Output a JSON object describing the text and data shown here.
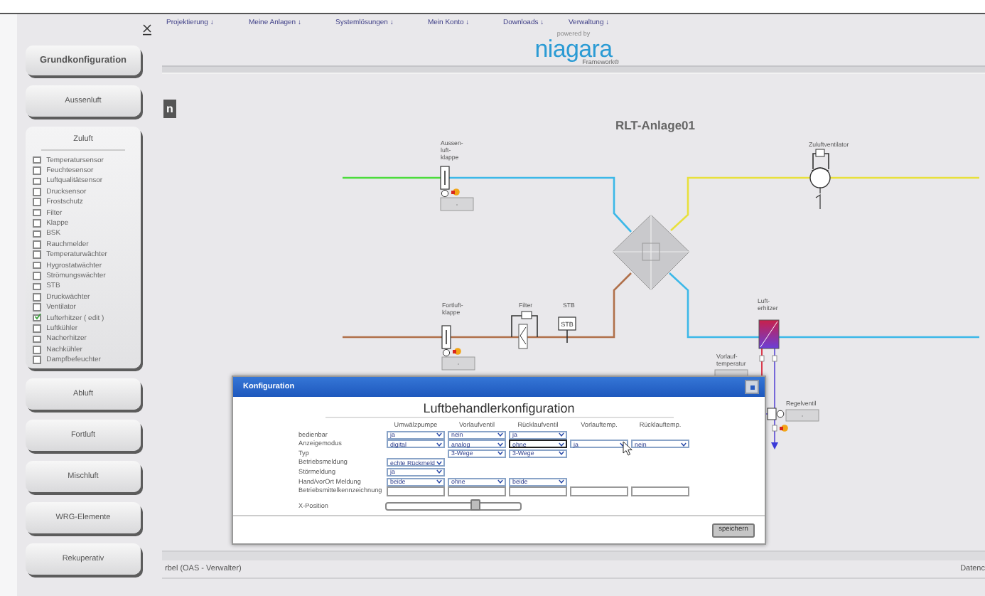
{
  "sidebar": {
    "sections": [
      {
        "label": "Grundkonfiguration",
        "expanded": false
      },
      {
        "label": "Aussenluft",
        "expanded": false
      },
      {
        "label": "Zuluft",
        "expanded": true,
        "options": [
          {
            "label": "Temperatursensor",
            "checked": false
          },
          {
            "label": "Feuchtesensor",
            "checked": false
          },
          {
            "label": "Luftqualitätsensor",
            "checked": false
          },
          {
            "label": "Drucksensor",
            "checked": false
          },
          {
            "label": "Frostschutz",
            "checked": false
          },
          {
            "label": "Filter",
            "checked": false
          },
          {
            "label": "Klappe",
            "checked": false
          },
          {
            "label": "BSK",
            "checked": false
          },
          {
            "label": "Rauchmelder",
            "checked": false
          },
          {
            "label": "Temperaturwächter",
            "checked": false
          },
          {
            "label": "Hygrostatwächter",
            "checked": false
          },
          {
            "label": "Strömungswächter",
            "checked": false
          },
          {
            "label": "STB",
            "checked": false
          },
          {
            "label": "Druckwächter",
            "checked": false
          },
          {
            "label": "Ventilator",
            "checked": false
          },
          {
            "label": "Lufterhitzer ( edit )",
            "checked": true
          },
          {
            "label": "Luftkühler",
            "checked": false
          },
          {
            "label": "Nacherhitzer",
            "checked": false
          },
          {
            "label": "Nachkühler",
            "checked": false
          },
          {
            "label": "Dampfbefeuchter",
            "checked": false
          }
        ]
      },
      {
        "label": "Abluft",
        "expanded": false
      },
      {
        "label": "Fortluft",
        "expanded": false
      },
      {
        "label": "Mischluft",
        "expanded": false
      },
      {
        "label": "WRG-Elemente",
        "expanded": false
      },
      {
        "label": "Rekuperativ",
        "expanded": false
      }
    ]
  },
  "nav": [
    "Projektierung ↓",
    "Meine Anlagen ↓",
    "Systemlösungen ↓",
    "Mein Konto ↓",
    "Downloads ↓",
    "Verwaltung ↓"
  ],
  "logo": {
    "tagline": "powered by",
    "name": "niagara",
    "suffix": "Framework®"
  },
  "tab": {
    "label": "n"
  },
  "diagram": {
    "title": "RLT-Anlage01",
    "components": [
      {
        "kind": "damper",
        "label": [
          "Aussen-",
          "luft-",
          "klappe"
        ],
        "display": "-"
      },
      {
        "kind": "damper",
        "label": [
          "Fortluft-",
          "klappe"
        ],
        "display": "-"
      },
      {
        "kind": "filter",
        "label": [
          "Filter"
        ]
      },
      {
        "kind": "stb",
        "label": [
          "STB"
        ],
        "display": "STB"
      },
      {
        "kind": "fan",
        "label": [
          "Zuluftventilator"
        ]
      },
      {
        "kind": "heater",
        "label": [
          "Luft-",
          "erhitzer"
        ]
      },
      {
        "kind": "sensor",
        "label": [
          "Vorlauf-",
          "temperatur"
        ]
      },
      {
        "kind": "valve",
        "label": [
          "Regelventil"
        ],
        "display": "-"
      }
    ]
  },
  "dialog": {
    "title": "Konfiguration",
    "heading": "Luftbehandlerkonfiguration",
    "columns": [
      "Umwälzpumpe",
      "Vorlaufventil",
      "Rücklaufventil",
      "Vorlauftemp.",
      "Rücklauftemp."
    ],
    "rows": [
      {
        "label": "bedienbar",
        "cells": [
          {
            "kind": "select",
            "value": "ja",
            "focused": false
          },
          {
            "kind": "select",
            "value": "nein",
            "focused": false
          },
          {
            "kind": "select",
            "value": "ja",
            "focused": false
          },
          {
            "kind": "empty"
          },
          {
            "kind": "empty"
          }
        ]
      },
      {
        "label": "Anzeigemodus",
        "cells": [
          {
            "kind": "select",
            "value": "digital",
            "focused": false
          },
          {
            "kind": "select",
            "value": "analog",
            "focused": false
          },
          {
            "kind": "select",
            "value": "ohne",
            "focused": true
          },
          {
            "kind": "select",
            "value": "ja",
            "focused": false
          },
          {
            "kind": "select",
            "value": "nein",
            "focused": false
          }
        ]
      },
      {
        "label": "Typ",
        "cells": [
          {
            "kind": "empty"
          },
          {
            "kind": "select",
            "value": "3-Wege",
            "focused": false
          },
          {
            "kind": "select",
            "value": "3-Wege",
            "focused": false
          },
          {
            "kind": "empty"
          },
          {
            "kind": "empty"
          }
        ]
      },
      {
        "label": "Betriebsmeldung",
        "cells": [
          {
            "kind": "select",
            "value": "echte Rückmeld",
            "focused": false
          },
          {
            "kind": "empty"
          },
          {
            "kind": "empty"
          },
          {
            "kind": "empty"
          },
          {
            "kind": "empty"
          }
        ]
      },
      {
        "label": "Störmeldung",
        "cells": [
          {
            "kind": "select",
            "value": "ja",
            "focused": false
          },
          {
            "kind": "empty"
          },
          {
            "kind": "empty"
          },
          {
            "kind": "empty"
          },
          {
            "kind": "empty"
          }
        ]
      },
      {
        "label": "Hand/vorOrt Meldung",
        "cells": [
          {
            "kind": "select",
            "value": "beide",
            "focused": false
          },
          {
            "kind": "select",
            "value": "ohne",
            "focused": false
          },
          {
            "kind": "select",
            "value": "beide",
            "focused": false
          },
          {
            "kind": "empty"
          },
          {
            "kind": "empty"
          }
        ]
      },
      {
        "label": "Betriebsmittelkennzeichnung",
        "cells": [
          {
            "kind": "input"
          },
          {
            "kind": "input"
          },
          {
            "kind": "input"
          },
          {
            "kind": "input"
          },
          {
            "kind": "input"
          }
        ]
      }
    ],
    "slider": {
      "label": "X-Position",
      "level": 0.66
    },
    "button": "speichern"
  },
  "status_bar": {
    "user": "rbel (OAS - Verwalter)",
    "right": "Datenc"
  }
}
